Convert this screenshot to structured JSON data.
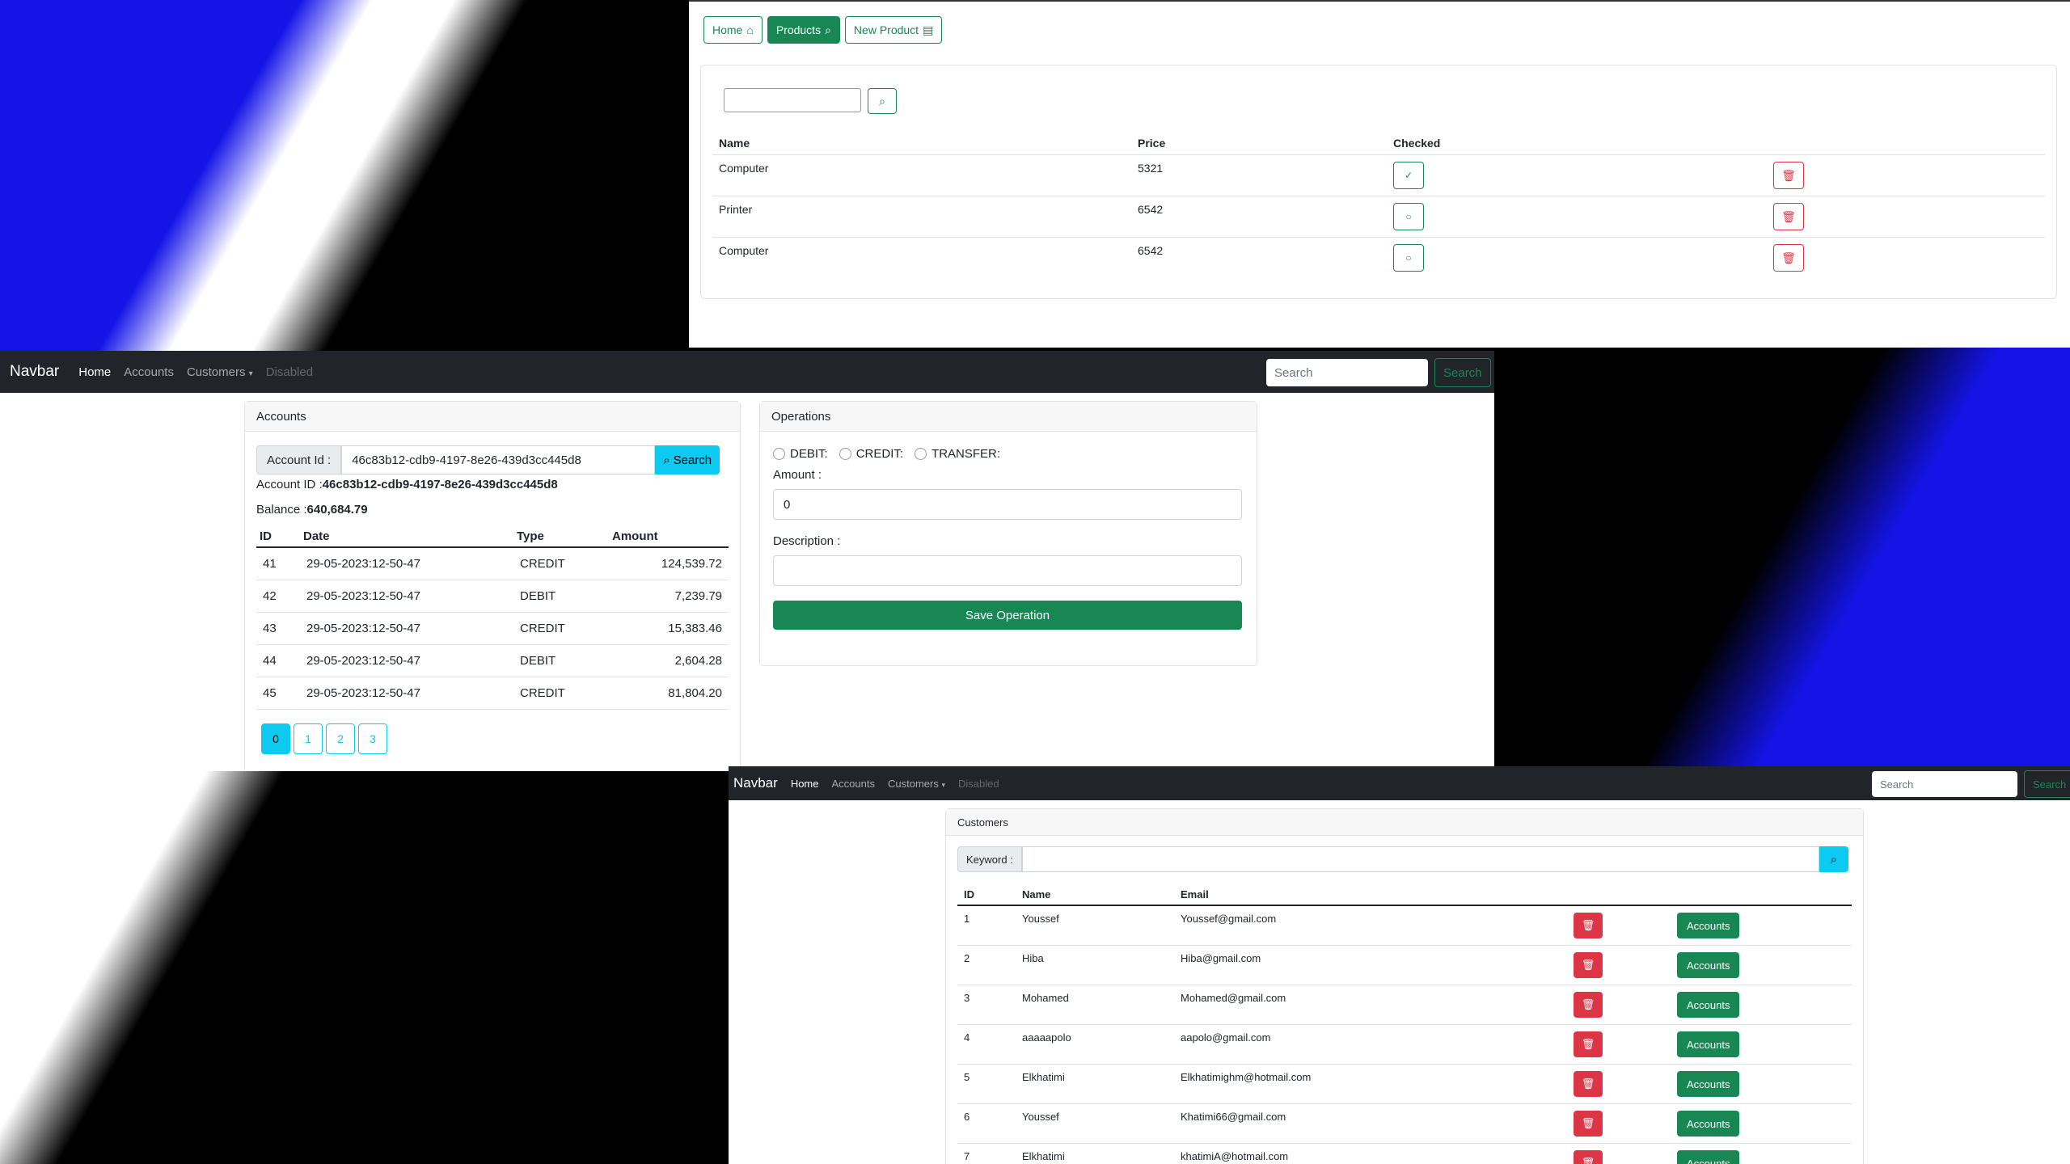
{
  "products_app": {
    "nav": {
      "home": "Home",
      "products": "Products",
      "new_product": "New Product"
    },
    "search_value": "",
    "table": {
      "headers": [
        "Name",
        "Price",
        "Checked"
      ],
      "rows": [
        {
          "name": "Computer",
          "price": "5321",
          "checked": true
        },
        {
          "name": "Printer",
          "price": "6542",
          "checked": false
        },
        {
          "name": "Computer",
          "price": "6542",
          "checked": false
        }
      ]
    }
  },
  "accounts_app": {
    "navbar": {
      "brand": "Navbar",
      "home": "Home",
      "accounts": "Accounts",
      "customers": "Customers",
      "disabled": "Disabled",
      "search_placeholder": "Search",
      "search_button": "Search"
    },
    "accounts_card": {
      "title": "Accounts",
      "account_id_label": "Account Id :",
      "account_id_value": "46c83b12-cdb9-4197-8e26-439d3cc445d8",
      "search_button": "Search",
      "account_id_info_label": "Account ID :",
      "account_id_info_value": "46c83b12-cdb9-4197-8e26-439d3cc445d8",
      "balance_label": "Balance :",
      "balance_value": "640,684.79",
      "headers": [
        "ID",
        "Date",
        "Type",
        "Amount"
      ],
      "operations": [
        {
          "id": "41",
          "date": "29-05-2023:12-50-47",
          "type": "CREDIT",
          "amount": "124,539.72"
        },
        {
          "id": "42",
          "date": "29-05-2023:12-50-47",
          "type": "DEBIT",
          "amount": "7,239.79"
        },
        {
          "id": "43",
          "date": "29-05-2023:12-50-47",
          "type": "CREDIT",
          "amount": "15,383.46"
        },
        {
          "id": "44",
          "date": "29-05-2023:12-50-47",
          "type": "DEBIT",
          "amount": "2,604.28"
        },
        {
          "id": "45",
          "date": "29-05-2023:12-50-47",
          "type": "CREDIT",
          "amount": "81,804.20"
        }
      ],
      "pages": [
        "0",
        "1",
        "2",
        "3"
      ],
      "current_page": "0"
    },
    "operations_card": {
      "title": "Operations",
      "debit": "DEBIT:",
      "credit": "CREDIT:",
      "transfer": "TRANSFER:",
      "amount_label": "Amount :",
      "amount_value": "0",
      "description_label": "Description :",
      "description_value": "",
      "save_button": "Save Operation"
    }
  },
  "customers_app": {
    "navbar": {
      "brand": "Navbar",
      "home": "Home",
      "accounts": "Accounts",
      "customers": "Customers",
      "disabled": "Disabled",
      "search_placeholder": "Search",
      "search_button": "Search"
    },
    "card_title": "Customers",
    "keyword_label": "Keyword :",
    "headers": [
      "ID",
      "Name",
      "Email"
    ],
    "accounts_button": "Accounts",
    "rows": [
      {
        "id": "1",
        "name": "Youssef",
        "email": "Youssef@gmail.com"
      },
      {
        "id": "2",
        "name": "Hiba",
        "email": "Hiba@gmail.com"
      },
      {
        "id": "3",
        "name": "Mohamed",
        "email": "Mohamed@gmail.com"
      },
      {
        "id": "4",
        "name": "aaaaapolo",
        "email": "aapolo@gmail.com"
      },
      {
        "id": "5",
        "name": "Elkhatimi",
        "email": "Elkhatimighm@hotmail.com"
      },
      {
        "id": "6",
        "name": "Youssef",
        "email": "Khatimi66@gmail.com"
      },
      {
        "id": "7",
        "name": "Elkhatimi",
        "email": "khatimiA@hotmail.com"
      }
    ]
  },
  "colors": {
    "success": "#198754",
    "danger": "#dc3545",
    "info": "#0dcaf0",
    "dark": "#212529"
  }
}
